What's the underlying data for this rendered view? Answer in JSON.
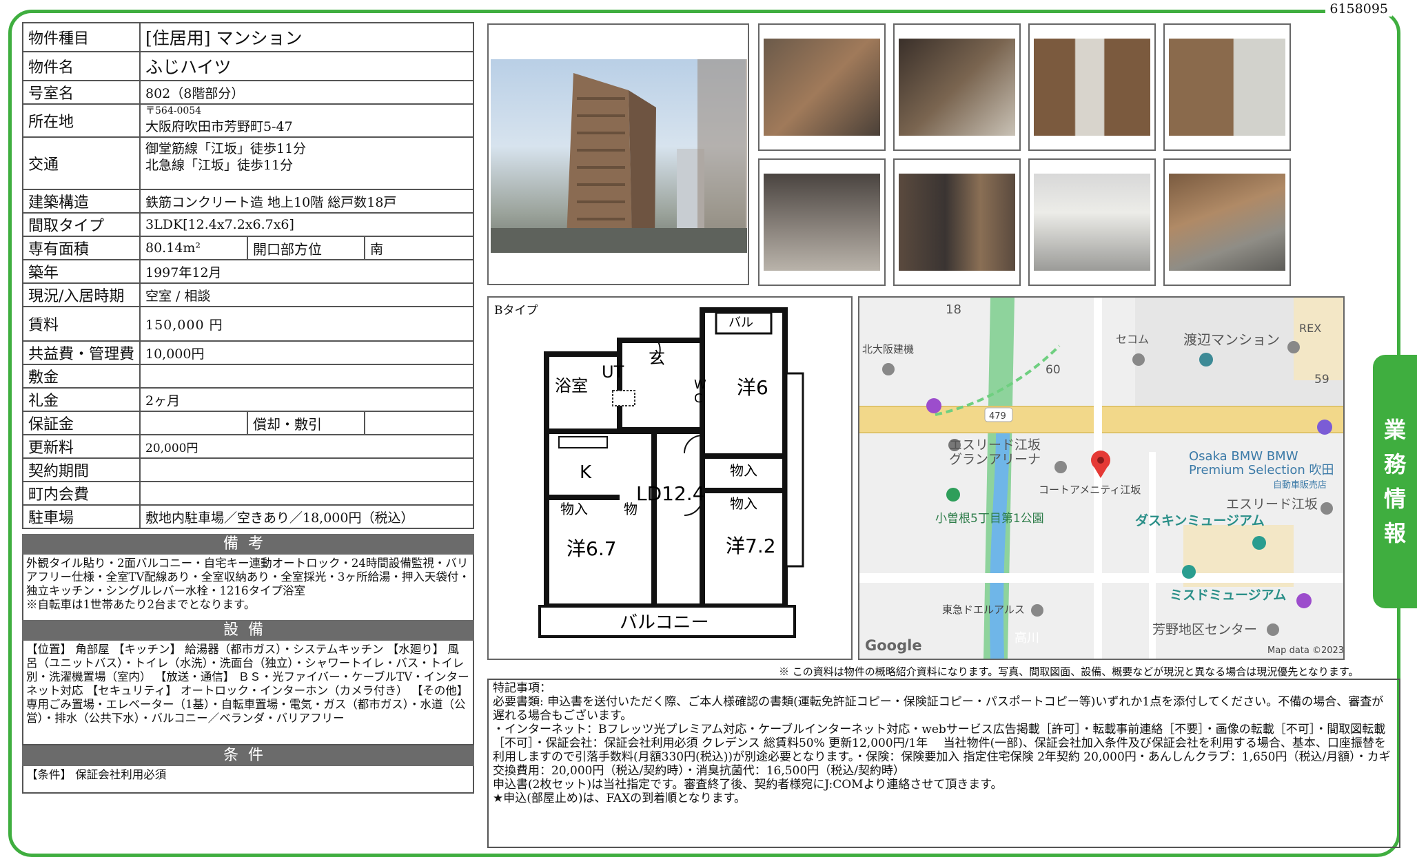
{
  "doc_id": "6158095",
  "spec": {
    "type_label": "物件種目",
    "type_value": "[住居用] マンション",
    "name_label": "物件名",
    "name_value": "ふじハイツ",
    "room_label": "号室名",
    "room_value": "802（8階部分）",
    "address_label": "所在地",
    "postal": "〒564-0054",
    "address_value": "大阪府吹田市芳野町5-47",
    "transport_label": "交通",
    "transport_1": "御堂筋線「江坂」徒歩11分",
    "transport_2": "北急線「江坂」徒歩11分",
    "structure_label": "建築構造",
    "structure_value": "鉄筋コンクリート造 地上10階 総戸数18戸",
    "layout_label": "間取タイプ",
    "layout_value": "3LDK[12.4x7.2x6.7x6]",
    "area_label": "専有面積",
    "area_value": "80.14m²",
    "direction_label": "開口部方位",
    "direction_value": "南",
    "built_label": "築年",
    "built_value": "1997年12月",
    "status_label": "現況/入居時期",
    "status_value": "空室 / 相談",
    "rent_label": "賃料",
    "rent_value": "150,000 円",
    "fee_label": "共益費・管理費",
    "fee_value": "10,000円",
    "deposit_label": "敷金",
    "deposit_value": "",
    "key_money_label": "礼金",
    "key_money_value": "2ヶ月",
    "guarantee_label": "保証金",
    "guarantee_value": "",
    "amort_label": "償却・敷引",
    "amort_value": "",
    "renewal_label": "更新料",
    "renewal_value": "20,000円",
    "contract_label": "契約期間",
    "contract_value": "",
    "community_label": "町内会費",
    "community_value": "",
    "parking_label": "駐車場",
    "parking_value": "敷地内駐車場／空きあり／18,000円（税込）"
  },
  "bikou": {
    "title": "備考",
    "text": "外観タイル貼り・2面バルコニー・自宅キー連動オートロック・24時間設備監視・バリアフリー仕様・全室TV配線あり・全室収納あり・全室採光・3ヶ所給湯・押入天袋付・独立キッチン・シングルレバー水栓・1216タイプ浴室\n※自転車は1世帯あたり2台までとなります。"
  },
  "setsubi": {
    "title": "設備",
    "text": "【位置】 角部屋 【キッチン】 給湯器（都市ガス）・システムキッチン 【水廻り】 風呂（ユニットバス）・トイレ（水洗）・洗面台（独立）・シャワートイレ・バス・トイレ別・洗濯機置場（室内） 【放送・通信】 ＢＳ・光ファイバー・ケーブルTV・インターネット対応 【セキュリティ】 オートロック・インターホン（カメラ付き） 【その他】 専用ごみ置場・エレベーター（1基）・自転車置場・電気・ガス（都市ガス）・水道（公営）・排水（公共下水）・バルコニー／ベランダ・バリアフリー"
  },
  "jouken": {
    "title": "条件",
    "text": "【条件】 保証会社利用必須"
  },
  "floorplan": {
    "type_label": "Bタイプ",
    "rooms": {
      "bath": "浴室",
      "ut": "UT",
      "entrance": "玄",
      "wc": "W\nC",
      "balcony_top": "バル",
      "western6": "洋6",
      "k": "K",
      "closet1": "物入",
      "closet2": "物入",
      "closet3": "物入",
      "closet4": "物",
      "ld": "LD12.4",
      "western67": "洋6.7",
      "western72": "洋7.2",
      "balcony": "バルコニー"
    }
  },
  "map": {
    "labels": {
      "n18": "18",
      "rex": "REX",
      "kita_osaka": "北大阪建機",
      "secom": "セコム",
      "watanabe": "渡辺マンション",
      "n60": "60",
      "n59": "59",
      "route": "479",
      "esreed_arena": "エスリード江坂\nグランアリーナ",
      "court": "コートアメニティ江坂",
      "park": "小曽根5丁目第1公園",
      "bmw": "Osaka BMW BMW\nPremium Selection 吹田",
      "bmw_sub": "自動車販売店",
      "esreed": "エスリード江坂",
      "duskin": "ダスキンミュージアム",
      "mister": "ミスドミュージアム",
      "tokyu": "東急ドエルアルス",
      "river": "高川",
      "yoshino": "芳野地区センター",
      "google": "Google",
      "mapdata": "Map data ©2023"
    },
    "colors": {
      "road": "#f2d88a",
      "green": "#8ed39c",
      "river": "#6fb6e8",
      "teal": "#2a9d8f",
      "pin": "#e53935"
    }
  },
  "note": "※ この資料は物件の概略紹介資料になります。写真、間取図面、設備、概要などが現況と異なる場合は現況優先となります。",
  "remarks": "特記事項：\n必要書類: 申込書を送付いただく際、ご本人様確認の書類(運転免許証コピー・保険証コピー・パスポートコピー等)いずれか1点を添付してください。不備の場合、審査が遅れる場合もございます。\n・インターネット：Bフレッツ光プレミアム対応・ケーブルインターネット対応・webサービス広告掲載［許可］・転載事前連絡［不要］・画像の転載［不可］・間取図転載［不可］・保証会社：保証会社利用必須 クレデンス 総賃料50% 更新12,000円/1年　 当社物件(一部)、保証会社加入条件及び保証会社を利用する場合、基本、口座振替を利用しますので引落手数料(月額330円(税込))が別途必要となります。・保険：保険要加入 指定住宅保険 2年契約 20,000円・あんしんクラブ：1,650円（税込/月額）・カギ交換費用：20,000円（税込/契約時）・消臭抗菌代：16,500円（税込/契約時）\n申込書(2枚セット)は当社指定です。審査終了後、契約者様宛にJ:COMより連絡させて頂きます。\n★申込(部屋止め)は、FAXの到着順となります。",
  "side_tab": [
    "業",
    "務",
    "情",
    "報"
  ]
}
